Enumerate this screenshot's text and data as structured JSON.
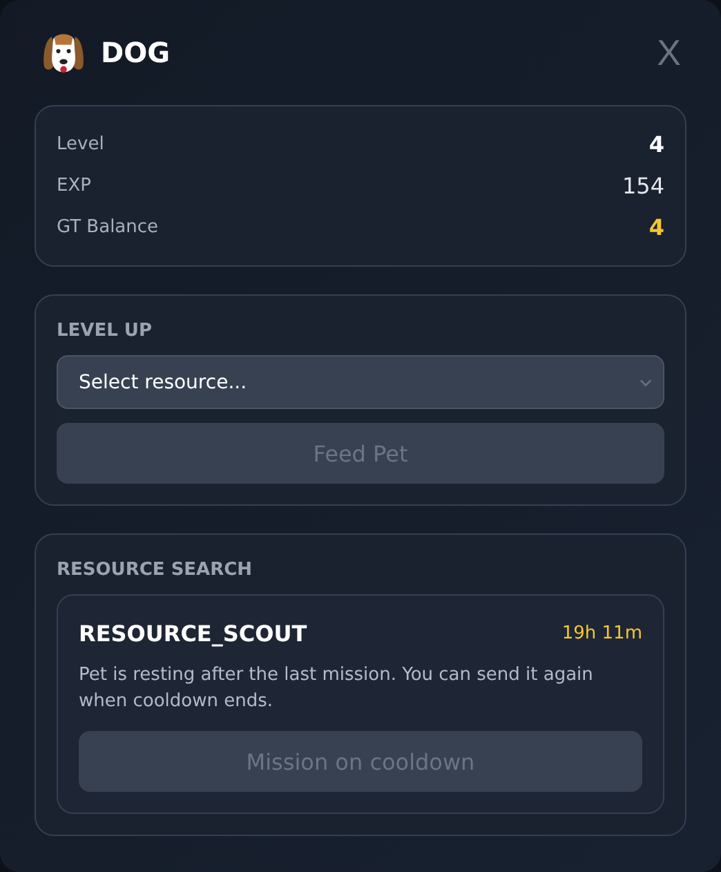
{
  "header": {
    "title": "DOG",
    "close": "X"
  },
  "stats": [
    {
      "label": "Level",
      "value": "4",
      "kind": "strong"
    },
    {
      "label": "EXP",
      "value": "154",
      "kind": "plain"
    },
    {
      "label": "GT Balance",
      "value": "4",
      "kind": "gold"
    }
  ],
  "level_up": {
    "heading": "LEVEL UP",
    "select": {
      "placeholder": "Select resource..."
    },
    "button": {
      "label": "Feed Pet",
      "disabled": true
    }
  },
  "resource_search": {
    "heading": "RESOURCE SEARCH",
    "mission": {
      "name": "RESOURCE_SCOUT",
      "timer": "19h 11m",
      "description": "Pet is resting after the last mission. You can send it again when cooldown ends.",
      "button": {
        "label": "Mission on cooldown",
        "disabled": true
      }
    }
  }
}
